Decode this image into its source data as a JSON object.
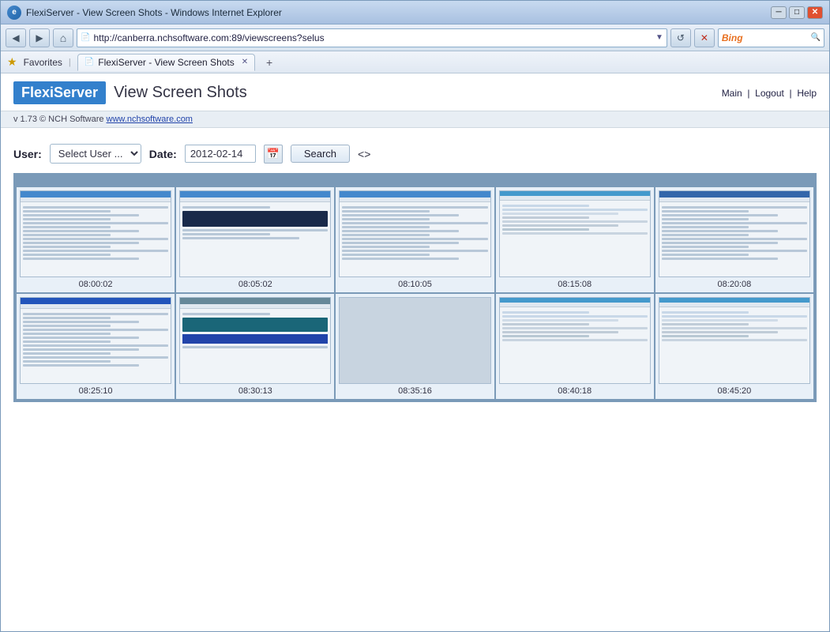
{
  "browser": {
    "title": "FlexiServer - View Screen Shots - Windows Internet Explorer",
    "address": "http://canberra.nchsoftware.com:89/viewscreens?selus",
    "tab_label": "FlexiServer - View Screen Shots",
    "favorites_label": "Favorites",
    "bing_label": "Bing",
    "ctrl_minimize": "─",
    "ctrl_restore": "□",
    "ctrl_close": "✕"
  },
  "header": {
    "brand": "FlexiServer",
    "page_title": "View Screen Shots",
    "nav_main": "Main",
    "nav_logout": "Logout",
    "nav_help": "Help",
    "version_text": "v 1.73 © NCH Software ",
    "version_url": "www.nchsoftware.com"
  },
  "filter": {
    "user_label": "User:",
    "user_placeholder": "Select User ...",
    "date_label": "Date:",
    "date_value": "2012-02-14",
    "search_label": "Search",
    "nav_arrows": "<>"
  },
  "screenshots": [
    {
      "time": "08:00:02",
      "type": "app"
    },
    {
      "time": "08:05:02",
      "type": "dark"
    },
    {
      "time": "08:10:05",
      "type": "app"
    },
    {
      "time": "08:15:08",
      "type": "light"
    },
    {
      "time": "08:20:08",
      "type": "appB"
    },
    {
      "time": "08:25:10",
      "type": "appC"
    },
    {
      "time": "08:30:13",
      "type": "teal"
    },
    {
      "time": "08:35:16",
      "type": "gray"
    },
    {
      "time": "08:40:18",
      "type": "lightB"
    },
    {
      "time": "08:45:20",
      "type": "lightC"
    }
  ]
}
